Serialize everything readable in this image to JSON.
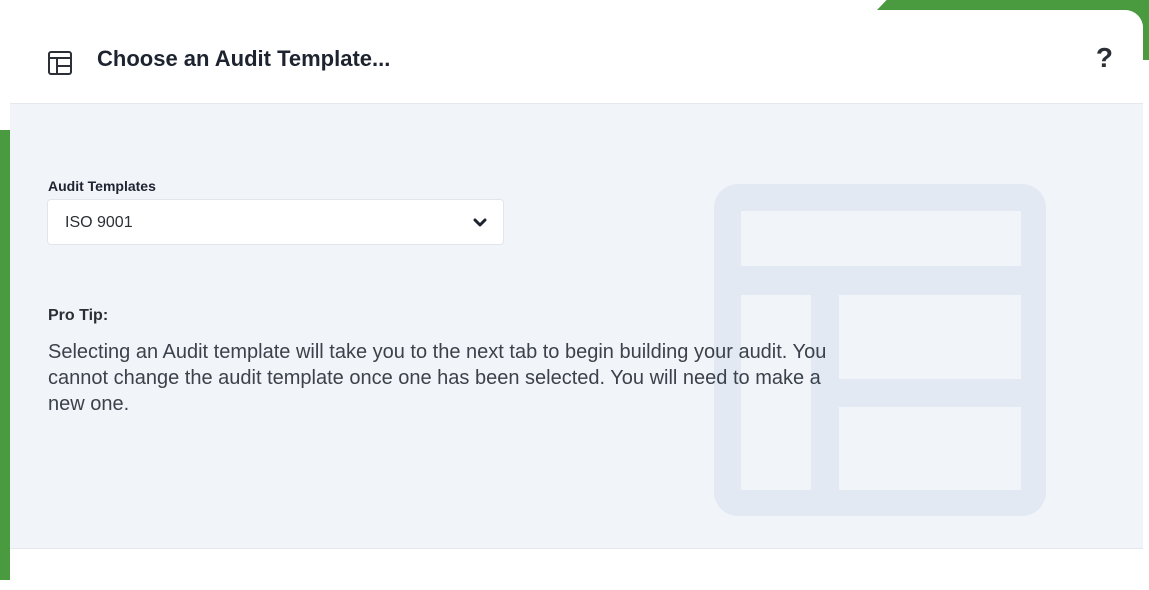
{
  "header": {
    "title": "Choose an Audit Template...",
    "icon": "template-layout-icon",
    "help_label": "?"
  },
  "form": {
    "label": "Audit Templates",
    "selected_value": "ISO 9001",
    "chevron_icon": "chevron-down-icon"
  },
  "tip": {
    "title": "Pro Tip:",
    "body": "Selecting an Audit template will take you to the next tab to begin building your audit. You cannot change the audit template once one has been selected. You will need to make a new one."
  },
  "watermark": {
    "icon": "template-layout-icon"
  },
  "colors": {
    "brand_green": "#4a9a3f",
    "panel_background": "#f1f4f8",
    "watermark": "#e3e9f2"
  }
}
